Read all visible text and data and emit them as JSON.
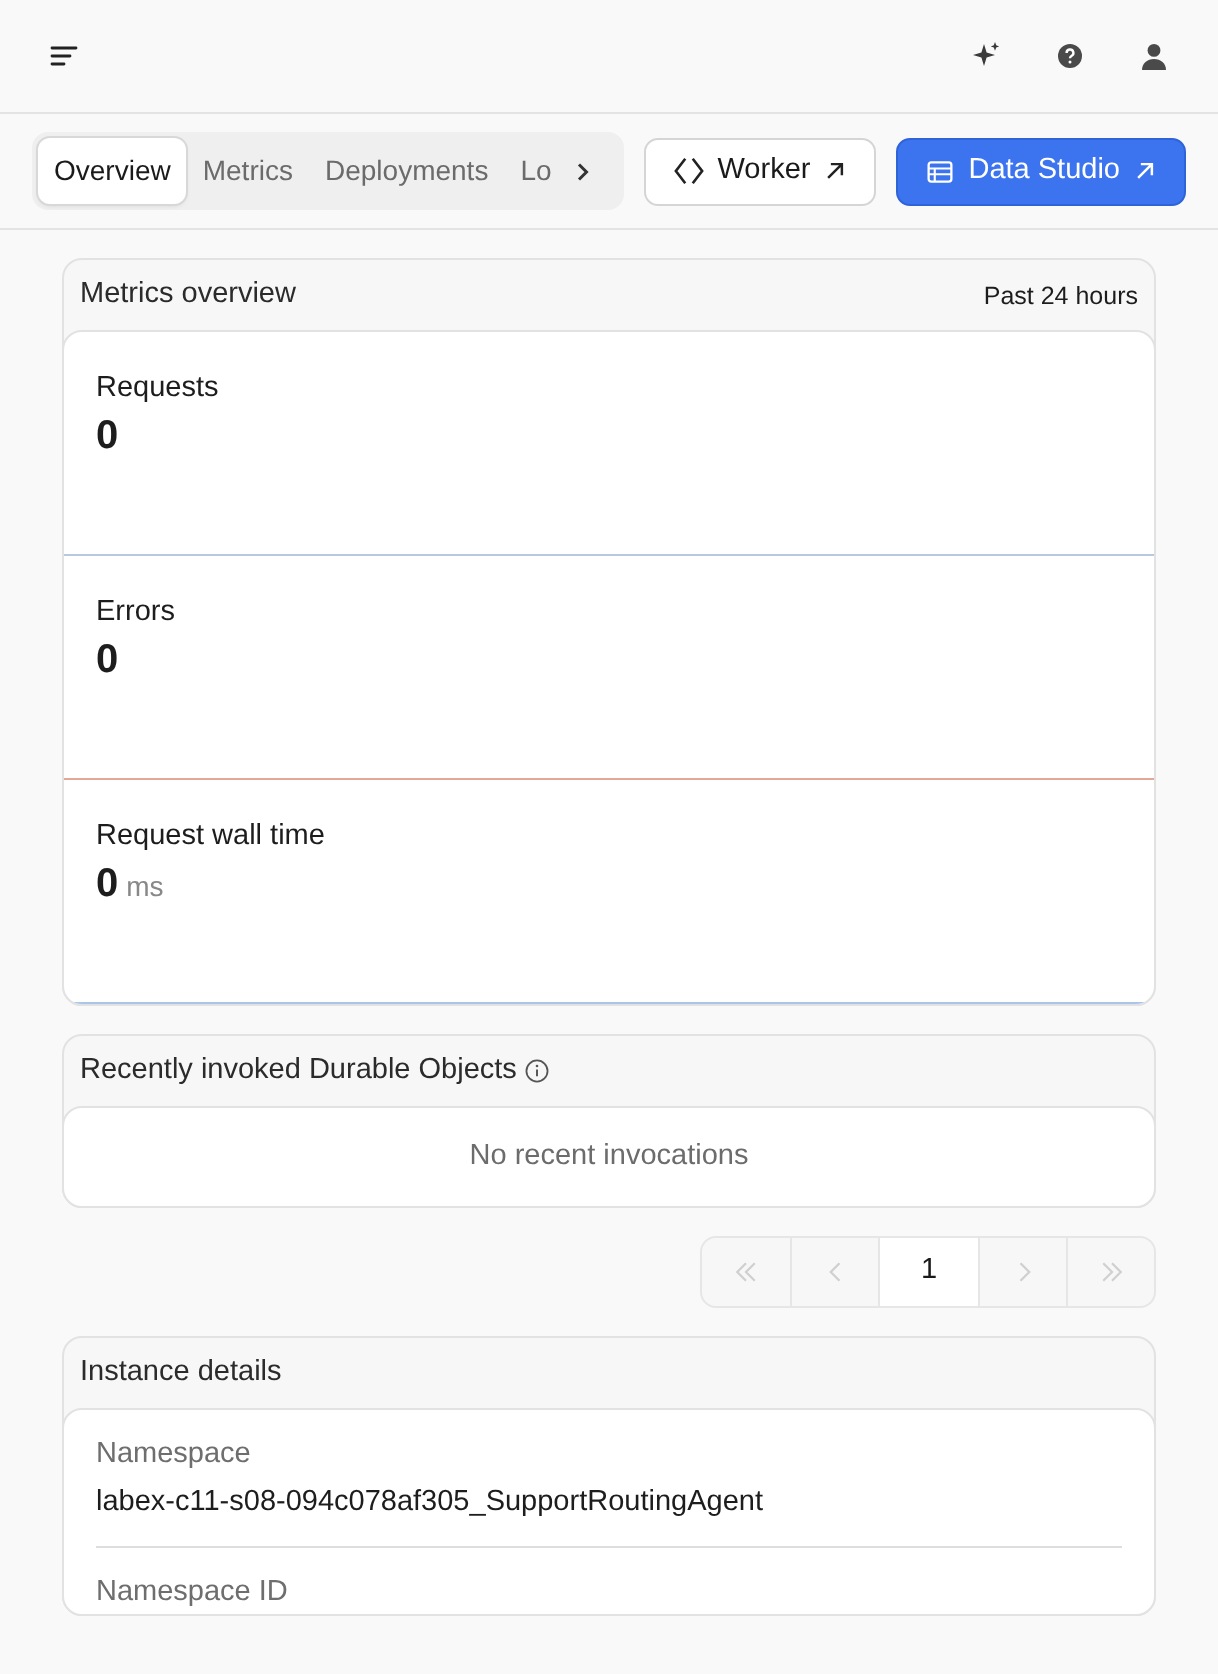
{
  "tabs": [
    {
      "label": "Overview",
      "selected": true
    },
    {
      "label": "Metrics",
      "selected": false
    },
    {
      "label": "Deployments",
      "selected": false
    },
    {
      "label": "Lo",
      "selected": false
    }
  ],
  "actions": [
    {
      "label": "Worker",
      "kind": "outline"
    },
    {
      "label": "Data Studio",
      "kind": "primary"
    }
  ],
  "metrics_overview": {
    "title": "Metrics overview",
    "range": "Past 24 hours",
    "metrics": [
      {
        "label": "Requests",
        "value": "0",
        "color": "#b9c7e0"
      },
      {
        "label": "Errors",
        "value": "0",
        "color": "#e2a797"
      },
      {
        "label": "Request wall time",
        "value": "0",
        "unit": "ms",
        "color": "#a9c5e8"
      }
    ]
  },
  "recent": {
    "title": "Recently invoked Durable Objects",
    "empty": "No recent invocations"
  },
  "pagination": [
    {
      "kind": "first",
      "disabled": true
    },
    {
      "kind": "prev",
      "disabled": true
    },
    {
      "kind": "page",
      "label": "1",
      "selected": true
    },
    {
      "kind": "next",
      "disabled": true
    },
    {
      "kind": "last",
      "disabled": true
    }
  ],
  "instance": {
    "title": "Instance details",
    "fields": [
      {
        "label": "Namespace",
        "value": "labex-c11-s08-094c078af305_SupportRoutingAgent"
      },
      {
        "label": "Namespace ID"
      }
    ]
  }
}
